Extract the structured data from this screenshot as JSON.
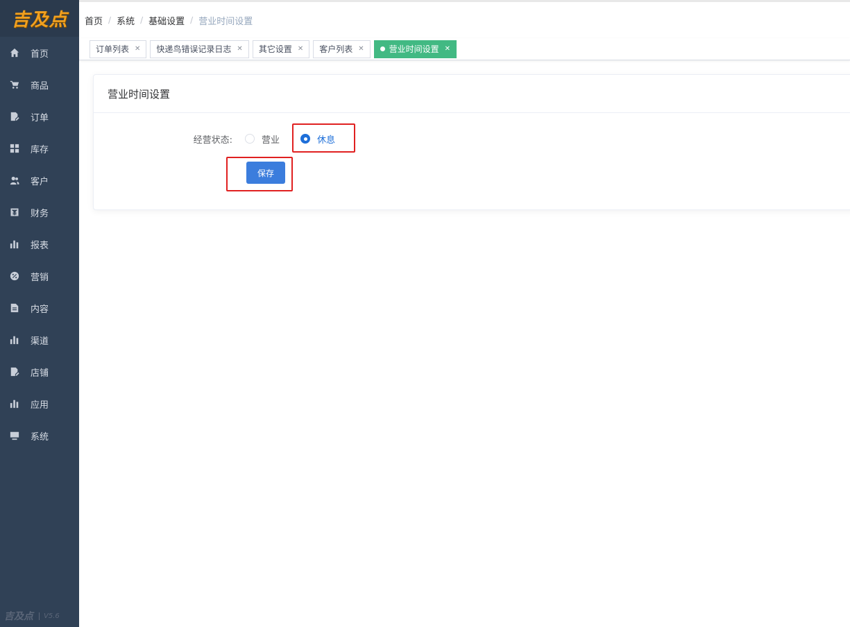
{
  "logo": {
    "text": "吉及点",
    "footer_text": "吉及点",
    "version": "V5.6"
  },
  "sidebar": {
    "items": [
      {
        "label": "首页",
        "icon": "home-icon"
      },
      {
        "label": "商品",
        "icon": "cart-icon"
      },
      {
        "label": "订单",
        "icon": "order-icon"
      },
      {
        "label": "库存",
        "icon": "grid-icon"
      },
      {
        "label": "客户",
        "icon": "users-icon"
      },
      {
        "label": "财务",
        "icon": "finance-icon"
      },
      {
        "label": "报表",
        "icon": "bar-chart-icon"
      },
      {
        "label": "营销",
        "icon": "percent-icon"
      },
      {
        "label": "内容",
        "icon": "document-icon"
      },
      {
        "label": "渠道",
        "icon": "bar-chart-icon"
      },
      {
        "label": "店铺",
        "icon": "order-icon"
      },
      {
        "label": "应用",
        "icon": "bar-chart-icon"
      },
      {
        "label": "系统",
        "icon": "monitor-icon"
      }
    ]
  },
  "breadcrumb": [
    "首页",
    "系统",
    "基础设置",
    "营业时间设置"
  ],
  "tags": [
    {
      "label": "订单列表",
      "active": false
    },
    {
      "label": "快递鸟错误记录日志",
      "active": false
    },
    {
      "label": "其它设置",
      "active": false
    },
    {
      "label": "客户列表",
      "active": false
    },
    {
      "label": "营业时间设置",
      "active": true
    }
  ],
  "card": {
    "title": "营业时间设置",
    "status_label": "经营状态:",
    "options": [
      {
        "label": "营业",
        "checked": false
      },
      {
        "label": "休息",
        "checked": true
      }
    ],
    "save_label": "保存"
  },
  "colors": {
    "sidebar": "#304156",
    "accent": "#42b983",
    "primary": "#3b7ddd",
    "highlight": "#e02020"
  }
}
